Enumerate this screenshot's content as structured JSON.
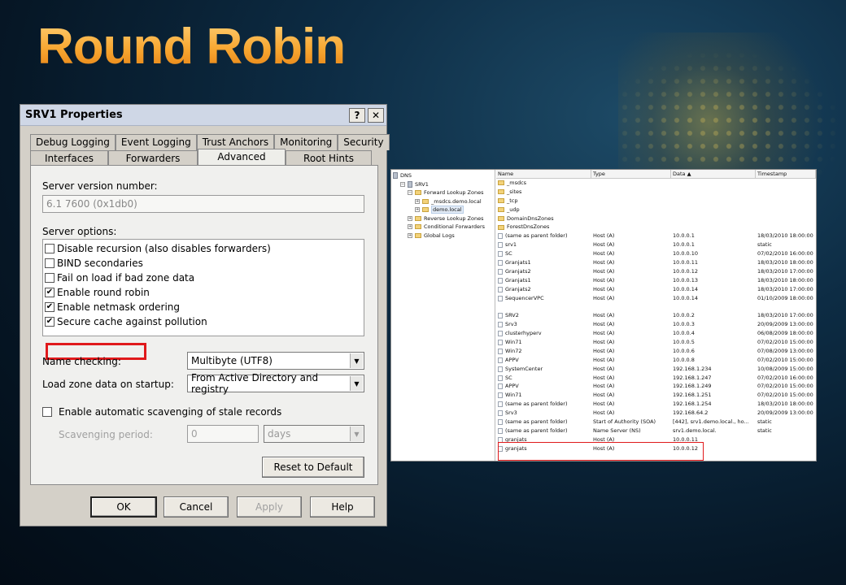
{
  "slide": {
    "title": "Round Robin"
  },
  "dialog": {
    "title": "SRV1 Properties",
    "help_btn": "?",
    "close_btn": "✕",
    "tabs_row1": [
      "Debug Logging",
      "Event Logging",
      "Trust Anchors",
      "Monitoring",
      "Security"
    ],
    "tabs_row2": [
      "Interfaces",
      "Forwarders",
      "Advanced",
      "Root Hints"
    ],
    "active_tab": "Advanced",
    "server_version_label": "Server version number:",
    "server_version_value": "6.1 7600 (0x1db0)",
    "server_options_label": "Server options:",
    "options": [
      {
        "label": "Disable recursion (also disables forwarders)",
        "checked": false
      },
      {
        "label": "BIND secondaries",
        "checked": false
      },
      {
        "label": "Fail on load if bad zone data",
        "checked": false
      },
      {
        "label": "Enable round robin",
        "checked": true
      },
      {
        "label": "Enable netmask ordering",
        "checked": true
      },
      {
        "label": "Secure cache against pollution",
        "checked": true
      }
    ],
    "name_checking_label": "Name checking:",
    "name_checking_value": "Multibyte (UTF8)",
    "load_zone_label": "Load zone data on startup:",
    "load_zone_value": "From Active Directory and registry",
    "scavenging_label": "Enable automatic scavenging of stale records",
    "scavenging_checked": false,
    "scavenging_period_label": "Scavenging period:",
    "scavenging_period_value": "0",
    "scavenging_unit": "days",
    "reset_label": "Reset to Default",
    "ok_label": "OK",
    "cancel_label": "Cancel",
    "apply_label": "Apply",
    "help_label": "Help"
  },
  "dns": {
    "tree": [
      {
        "label": "DNS",
        "indent": 0,
        "icon": "dns-root-icon",
        "expander": ""
      },
      {
        "label": "SRV1",
        "indent": 1,
        "icon": "server-icon",
        "expander": "−"
      },
      {
        "label": "Forward Lookup Zones",
        "indent": 2,
        "icon": "folder-icon",
        "expander": "−"
      },
      {
        "label": "_msdcs.demo.local",
        "indent": 3,
        "icon": "zone-icon",
        "expander": "+"
      },
      {
        "label": "demo.local",
        "indent": 3,
        "icon": "zone-icon",
        "expander": "+",
        "selected": true
      },
      {
        "label": "Reverse Lookup Zones",
        "indent": 2,
        "icon": "folder-icon",
        "expander": "+"
      },
      {
        "label": "Conditional Forwarders",
        "indent": 2,
        "icon": "folder-icon",
        "expander": "+"
      },
      {
        "label": "Global Logs",
        "indent": 2,
        "icon": "log-icon",
        "expander": "+"
      }
    ],
    "columns": [
      "Name",
      "Type",
      "Data  ▲",
      "Timestamp"
    ],
    "rows": [
      {
        "name": "_msdcs",
        "type": "",
        "data": "",
        "ts": "",
        "folder": true
      },
      {
        "name": "_sites",
        "type": "",
        "data": "",
        "ts": "",
        "folder": true
      },
      {
        "name": "_tcp",
        "type": "",
        "data": "",
        "ts": "",
        "folder": true
      },
      {
        "name": "_udp",
        "type": "",
        "data": "",
        "ts": "",
        "folder": true
      },
      {
        "name": "DomainDnsZones",
        "type": "",
        "data": "",
        "ts": "",
        "folder": true
      },
      {
        "name": "ForestDnsZones",
        "type": "",
        "data": "",
        "ts": "",
        "folder": true
      },
      {
        "name": "(same as parent folder)",
        "type": "Host (A)",
        "data": "10.0.0.1",
        "ts": "18/03/2010 18:00:00"
      },
      {
        "name": "srv1",
        "type": "Host (A)",
        "data": "10.0.0.1",
        "ts": "static"
      },
      {
        "name": "SC",
        "type": "Host (A)",
        "data": "10.0.0.10",
        "ts": "07/02/2010 16:00:00"
      },
      {
        "name": "Granjats1",
        "type": "Host (A)",
        "data": "10.0.0.11",
        "ts": "18/03/2010 18:00:00"
      },
      {
        "name": "Granjats2",
        "type": "Host (A)",
        "data": "10.0.0.12",
        "ts": "18/03/2010 17:00:00"
      },
      {
        "name": "Granjats1",
        "type": "Host (A)",
        "data": "10.0.0.13",
        "ts": "18/03/2010 18:00:00"
      },
      {
        "name": "Granjats2",
        "type": "Host (A)",
        "data": "10.0.0.14",
        "ts": "18/03/2010 17:00:00"
      },
      {
        "name": "SequencerVPC",
        "type": "Host (A)",
        "data": "10.0.0.14",
        "ts": "01/10/2009 18:00:00"
      },
      {
        "name": "",
        "type": "",
        "data": "",
        "ts": "",
        "blank": true
      },
      {
        "name": "SRV2",
        "type": "Host (A)",
        "data": "10.0.0.2",
        "ts": "18/03/2010 17:00:00"
      },
      {
        "name": "Srv3",
        "type": "Host (A)",
        "data": "10.0.0.3",
        "ts": "20/09/2009 13:00:00"
      },
      {
        "name": "clusterhyperv",
        "type": "Host (A)",
        "data": "10.0.0.4",
        "ts": "06/08/2009 18:00:00"
      },
      {
        "name": "Win71",
        "type": "Host (A)",
        "data": "10.0.0.5",
        "ts": "07/02/2010 15:00:00"
      },
      {
        "name": "Win72",
        "type": "Host (A)",
        "data": "10.0.0.6",
        "ts": "07/08/2009 13:00:00"
      },
      {
        "name": "APPV",
        "type": "Host (A)",
        "data": "10.0.0.8",
        "ts": "07/02/2010 15:00:00"
      },
      {
        "name": "SystemCenter",
        "type": "Host (A)",
        "data": "192.168.1.234",
        "ts": "10/08/2009 15:00:00"
      },
      {
        "name": "SC",
        "type": "Host (A)",
        "data": "192.168.1.247",
        "ts": "07/02/2010 16:00:00"
      },
      {
        "name": "APPV",
        "type": "Host (A)",
        "data": "192.168.1.249",
        "ts": "07/02/2010 15:00:00"
      },
      {
        "name": "Win71",
        "type": "Host (A)",
        "data": "192.168.1.251",
        "ts": "07/02/2010 15:00:00"
      },
      {
        "name": "(same as parent folder)",
        "type": "Host (A)",
        "data": "192.168.1.254",
        "ts": "18/03/2010 18:00:00"
      },
      {
        "name": "Srv3",
        "type": "Host (A)",
        "data": "192.168.64.2",
        "ts": "20/09/2009 13:00:00"
      },
      {
        "name": "(same as parent folder)",
        "type": "Start of Authority (SOA)",
        "data": "[442], srv1.demo.local., ho...",
        "ts": "static"
      },
      {
        "name": "(same as parent folder)",
        "type": "Name Server (NS)",
        "data": "srv1.demo.local.",
        "ts": "static"
      },
      {
        "name": "granjats",
        "type": "Host (A)",
        "data": "10.0.0.11",
        "ts": ""
      },
      {
        "name": "granjats",
        "type": "Host (A)",
        "data": "10.0.0.12",
        "ts": ""
      }
    ]
  }
}
